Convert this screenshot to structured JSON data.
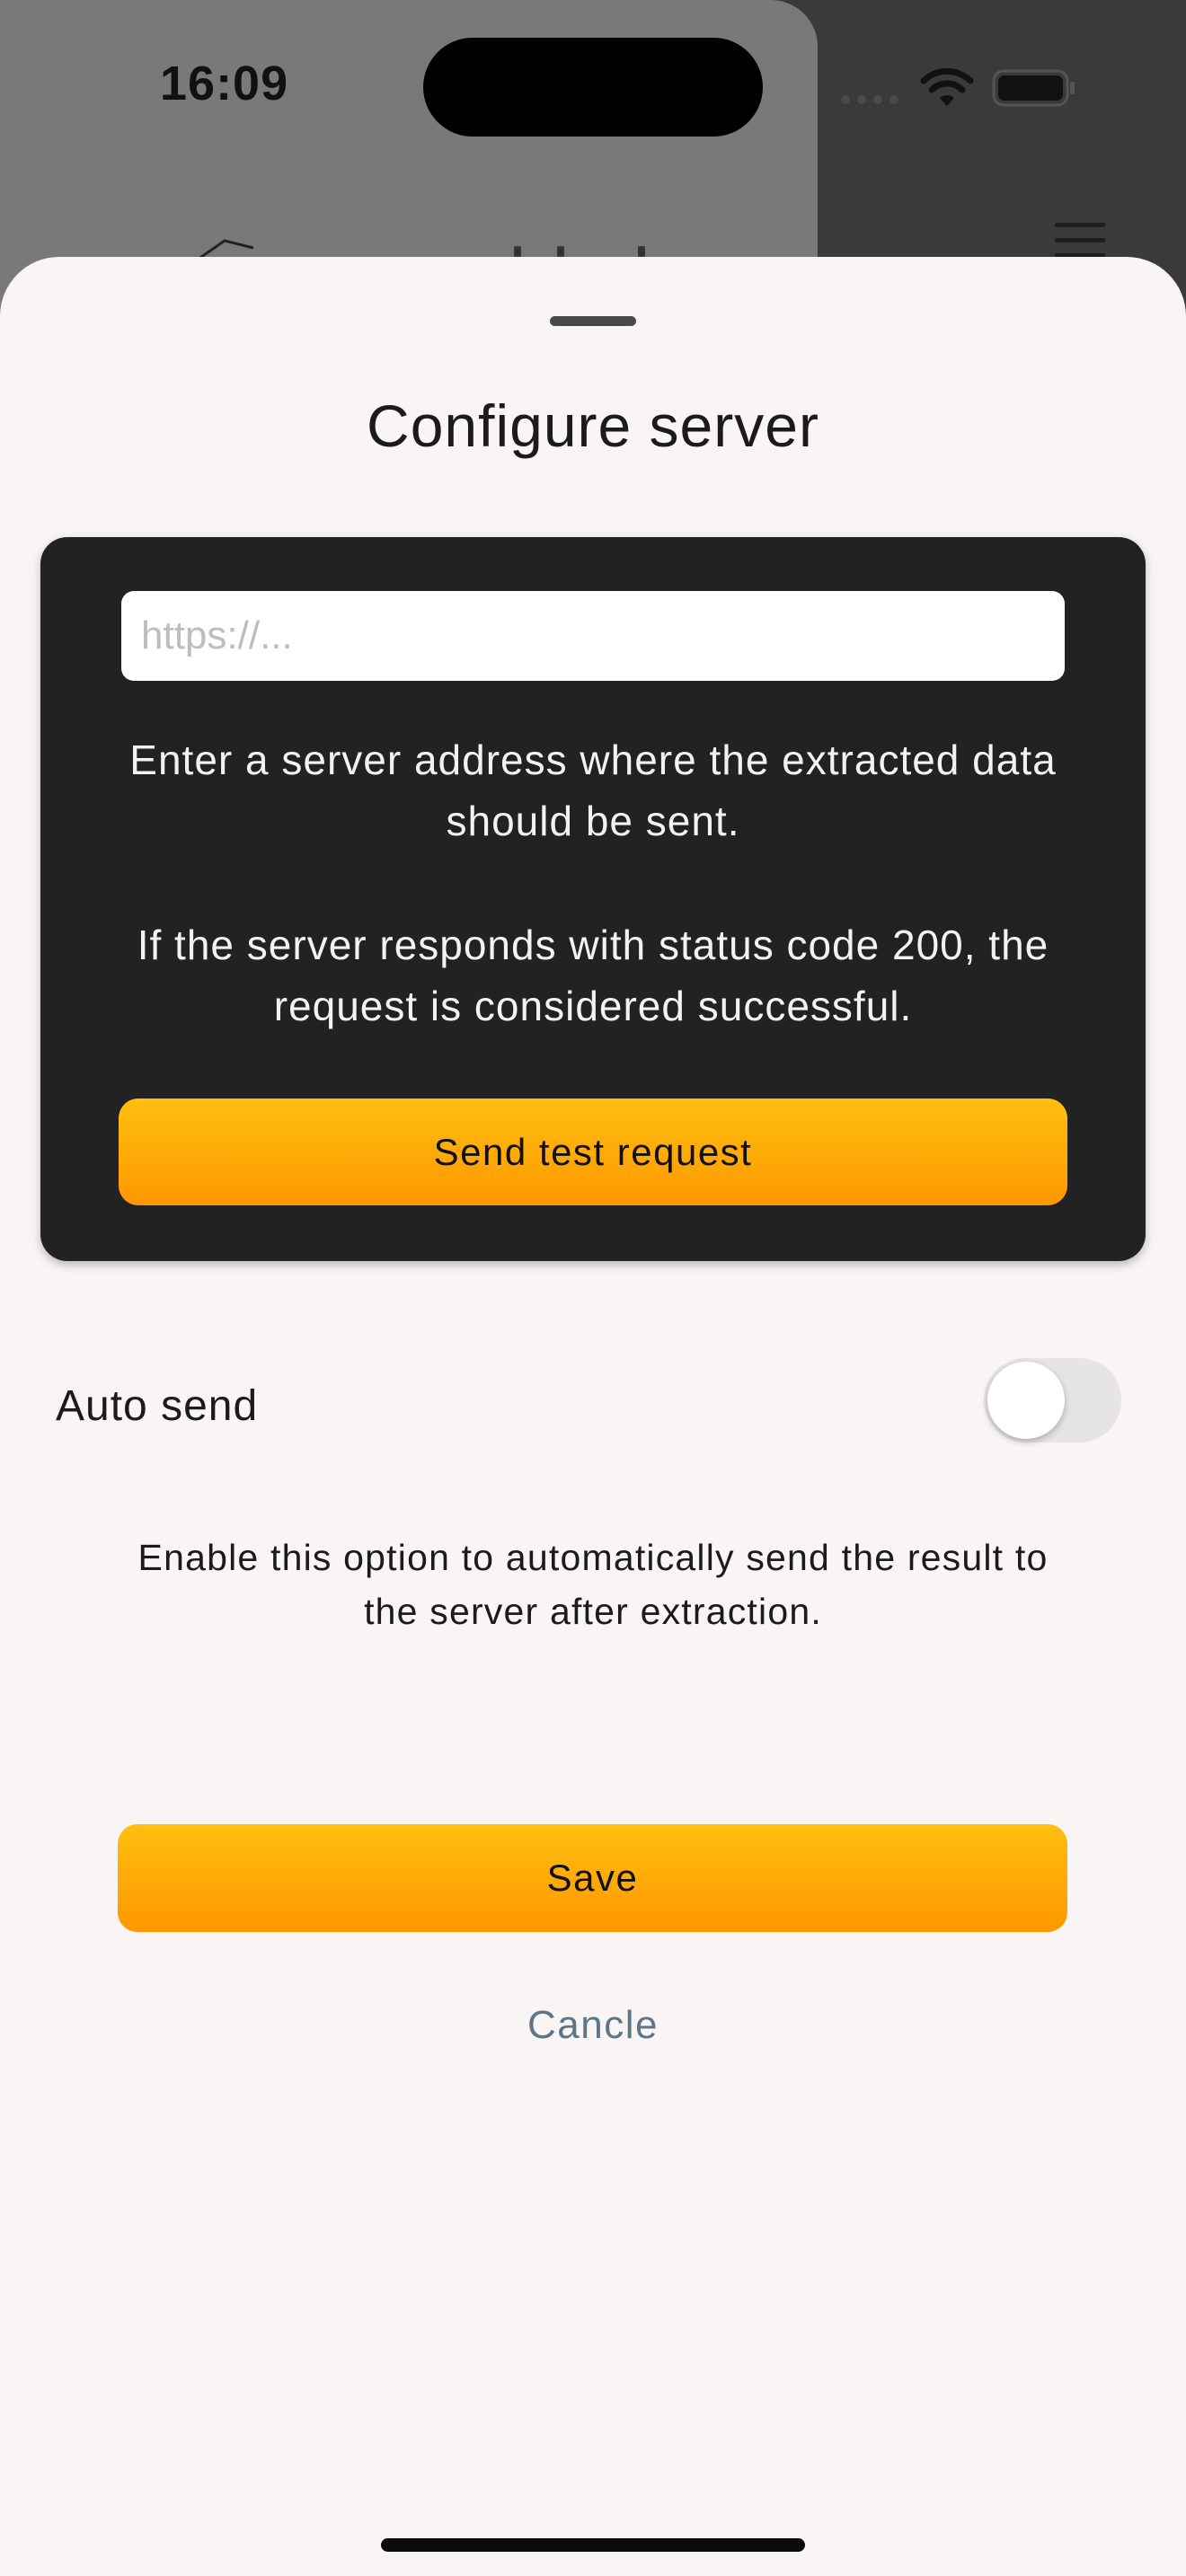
{
  "status_bar": {
    "time": "16:09"
  },
  "sheet": {
    "title": "Configure server",
    "server_card": {
      "url_placeholder": "https://...",
      "url_value": "",
      "description_1": "Enter a server address where the extracted data should be sent.",
      "description_2": "If the server responds with status code 200, the request is considered successful.",
      "test_button_label": "Send test request"
    },
    "auto_send": {
      "label": "Auto send",
      "enabled": false,
      "description": "Enable this option to automatically send the result to the server after extraction."
    },
    "save_label": "Save",
    "cancel_label": "Cancle"
  },
  "colors": {
    "accent_top": "#ffbf10",
    "accent_bottom": "#ff9700",
    "card_background": "#222222",
    "sheet_background": "#f8f5f4",
    "cancel_text": "#5e7685"
  },
  "icons": [
    "wifi-icon",
    "battery-icon",
    "menu-icon",
    "signal-dots-icon"
  ]
}
